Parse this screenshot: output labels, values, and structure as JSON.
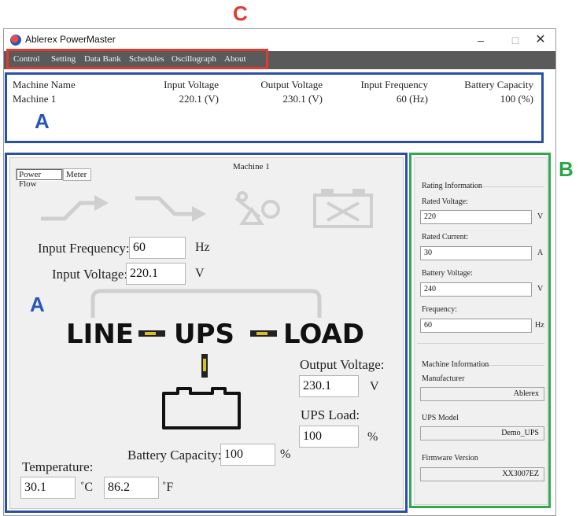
{
  "annotations": {
    "c": "C",
    "a_top": "A",
    "a_main": "A",
    "b": "B"
  },
  "window": {
    "title": "Ablerex PowerMaster",
    "min": "–",
    "max": "□",
    "close": "✕"
  },
  "menu": [
    "Control",
    "Setting",
    "Data Bank",
    "Schedules",
    "Oscillograph",
    "About"
  ],
  "summary": {
    "headers": [
      "Machine Name",
      "Input Voltage",
      "Output Voltage",
      "Input Frequency",
      "Battery Capacity"
    ],
    "values": [
      "Machine 1",
      "220.1 (V)",
      "230.1 (V)",
      "60 (Hz)",
      "100 (%)"
    ]
  },
  "panel": {
    "title": "Machine 1",
    "tabs": [
      "Power Flow",
      "Meter"
    ],
    "input_frequency": {
      "label": "Input Frequency:",
      "value": "60",
      "unit": "Hz"
    },
    "input_voltage": {
      "label": "Input Voltage:",
      "value": "220.1",
      "unit": "V"
    },
    "flow": {
      "line": "LINE",
      "ups": "UPS",
      "load": "LOAD"
    },
    "output_voltage": {
      "label": "Output Voltage:",
      "value": "230.1",
      "unit": "V"
    },
    "ups_load": {
      "label": "UPS Load:",
      "value": "100",
      "unit": "%"
    },
    "battery_capacity": {
      "label": "Battery Capacity:",
      "value": "100",
      "unit": "%"
    },
    "temperature": {
      "label": "Temperature:",
      "celsius": "30.1",
      "celsius_unit": "˚C",
      "fahrenheit": "86.2",
      "fahrenheit_unit": "˚F"
    }
  },
  "rating": {
    "title": "Rating Information",
    "rated_voltage": {
      "label": "Rated Voltage:",
      "value": "220",
      "unit": "V"
    },
    "rated_current": {
      "label": "Rated Current:",
      "value": "30",
      "unit": "A"
    },
    "battery_voltage": {
      "label": "Battery Voltage:",
      "value": "240",
      "unit": "V"
    },
    "frequency": {
      "label": "Frequency:",
      "value": "60",
      "unit": "Hz"
    }
  },
  "machine_info": {
    "title": "Machine Information",
    "manufacturer": {
      "label": "Manufacturer",
      "value": "Ablerex"
    },
    "ups_model": {
      "label": "UPS Model",
      "value": "Demo_UPS"
    },
    "firmware": {
      "label": "Firmware Version",
      "value": "XX3007EZ"
    }
  },
  "colors": {
    "annotation_red": "#e23a2e",
    "annotation_blue": "#2a4fa8",
    "annotation_green": "#2fa84f",
    "menubar": "#5a5a5a",
    "flow_arrow": "#d8c020"
  },
  "icons": [
    "app-icon",
    "bypass-icon",
    "inverter-icon",
    "fault-icon",
    "battery-fault-icon",
    "battery-icon"
  ]
}
